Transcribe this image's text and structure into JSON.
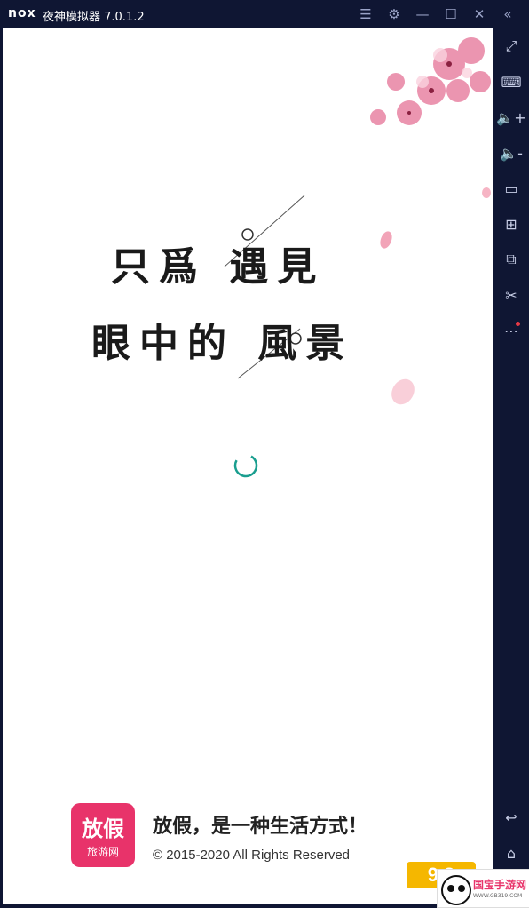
{
  "titlebar": {
    "logo": "nox",
    "title": "夜神模拟器 7.0.1.2",
    "icons": [
      "menu-icon",
      "settings-icon",
      "minimize-icon",
      "maximize-icon",
      "close-icon",
      "collapse-icon"
    ]
  },
  "sidebar": {
    "buttons": [
      "fullscreen",
      "keyboard",
      "volume-up",
      "volume-down",
      "screen",
      "add-apk",
      "multi-instance",
      "screenshot",
      "more"
    ],
    "bottom_buttons": [
      "back",
      "home"
    ]
  },
  "splash": {
    "poem_line1": "只爲 遇見",
    "poem_line2": "眼中的 風景",
    "slogan": "放假，是一种生活方式！",
    "copyright": "© 2015-2020 All Rights Reserved",
    "brand_logo_big": "放假",
    "brand_logo_small": "旅游网"
  },
  "watermark": {
    "number": "9 3",
    "site_name": "国宝手游网",
    "url": "WWW.GB319.COM"
  },
  "colors": {
    "frame": "#0f1633",
    "brand": "#e8336a",
    "spinner": "#1a9e8f"
  }
}
